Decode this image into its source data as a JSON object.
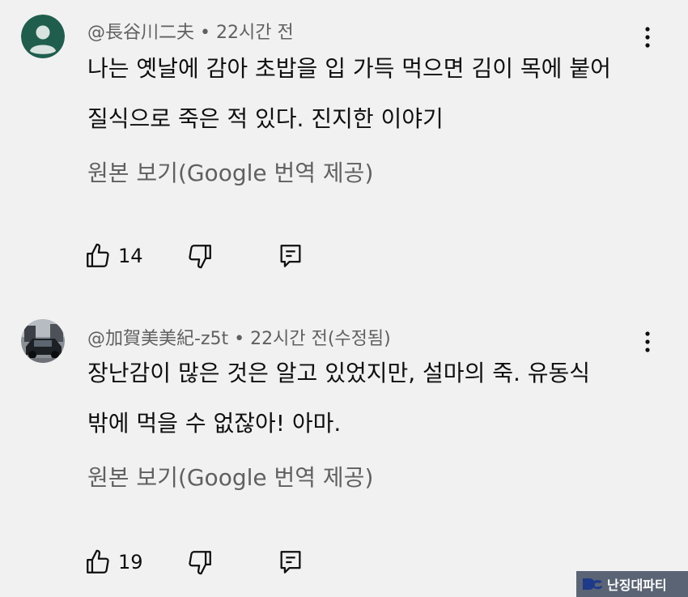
{
  "comments": [
    {
      "author": "@長谷川二夫",
      "separator": "•",
      "time": "22시간 전",
      "lines": [
        "나는 옛날에 감아 초밥을 입 가득 먹으면 김이 목에 붙어",
        "질식으로 죽은 적 있다. 진지한 이야기"
      ],
      "translate_label": "원본 보기(Google 번역 제공)",
      "like_count": "14",
      "avatar_color": "#1f5e4d"
    },
    {
      "author": "@加賀美美紀-z5t",
      "separator": "•",
      "time": "22시간 전(수정됨)",
      "lines": [
        "장난감이 많은 것은 알고 있었지만, 설마의 죽. 유동식",
        "밖에 먹을 수 없잖아! 아마."
      ],
      "translate_label": "원본 보기(Google 번역 제공)",
      "like_count": "19",
      "avatar_color": "#4a4f55"
    }
  ],
  "icons": {
    "like": "thumbs-up-icon",
    "dislike": "thumbs-down-icon",
    "reply": "reply-icon",
    "more": "more-vert-icon"
  },
  "watermark": {
    "text": "난징대파티"
  }
}
